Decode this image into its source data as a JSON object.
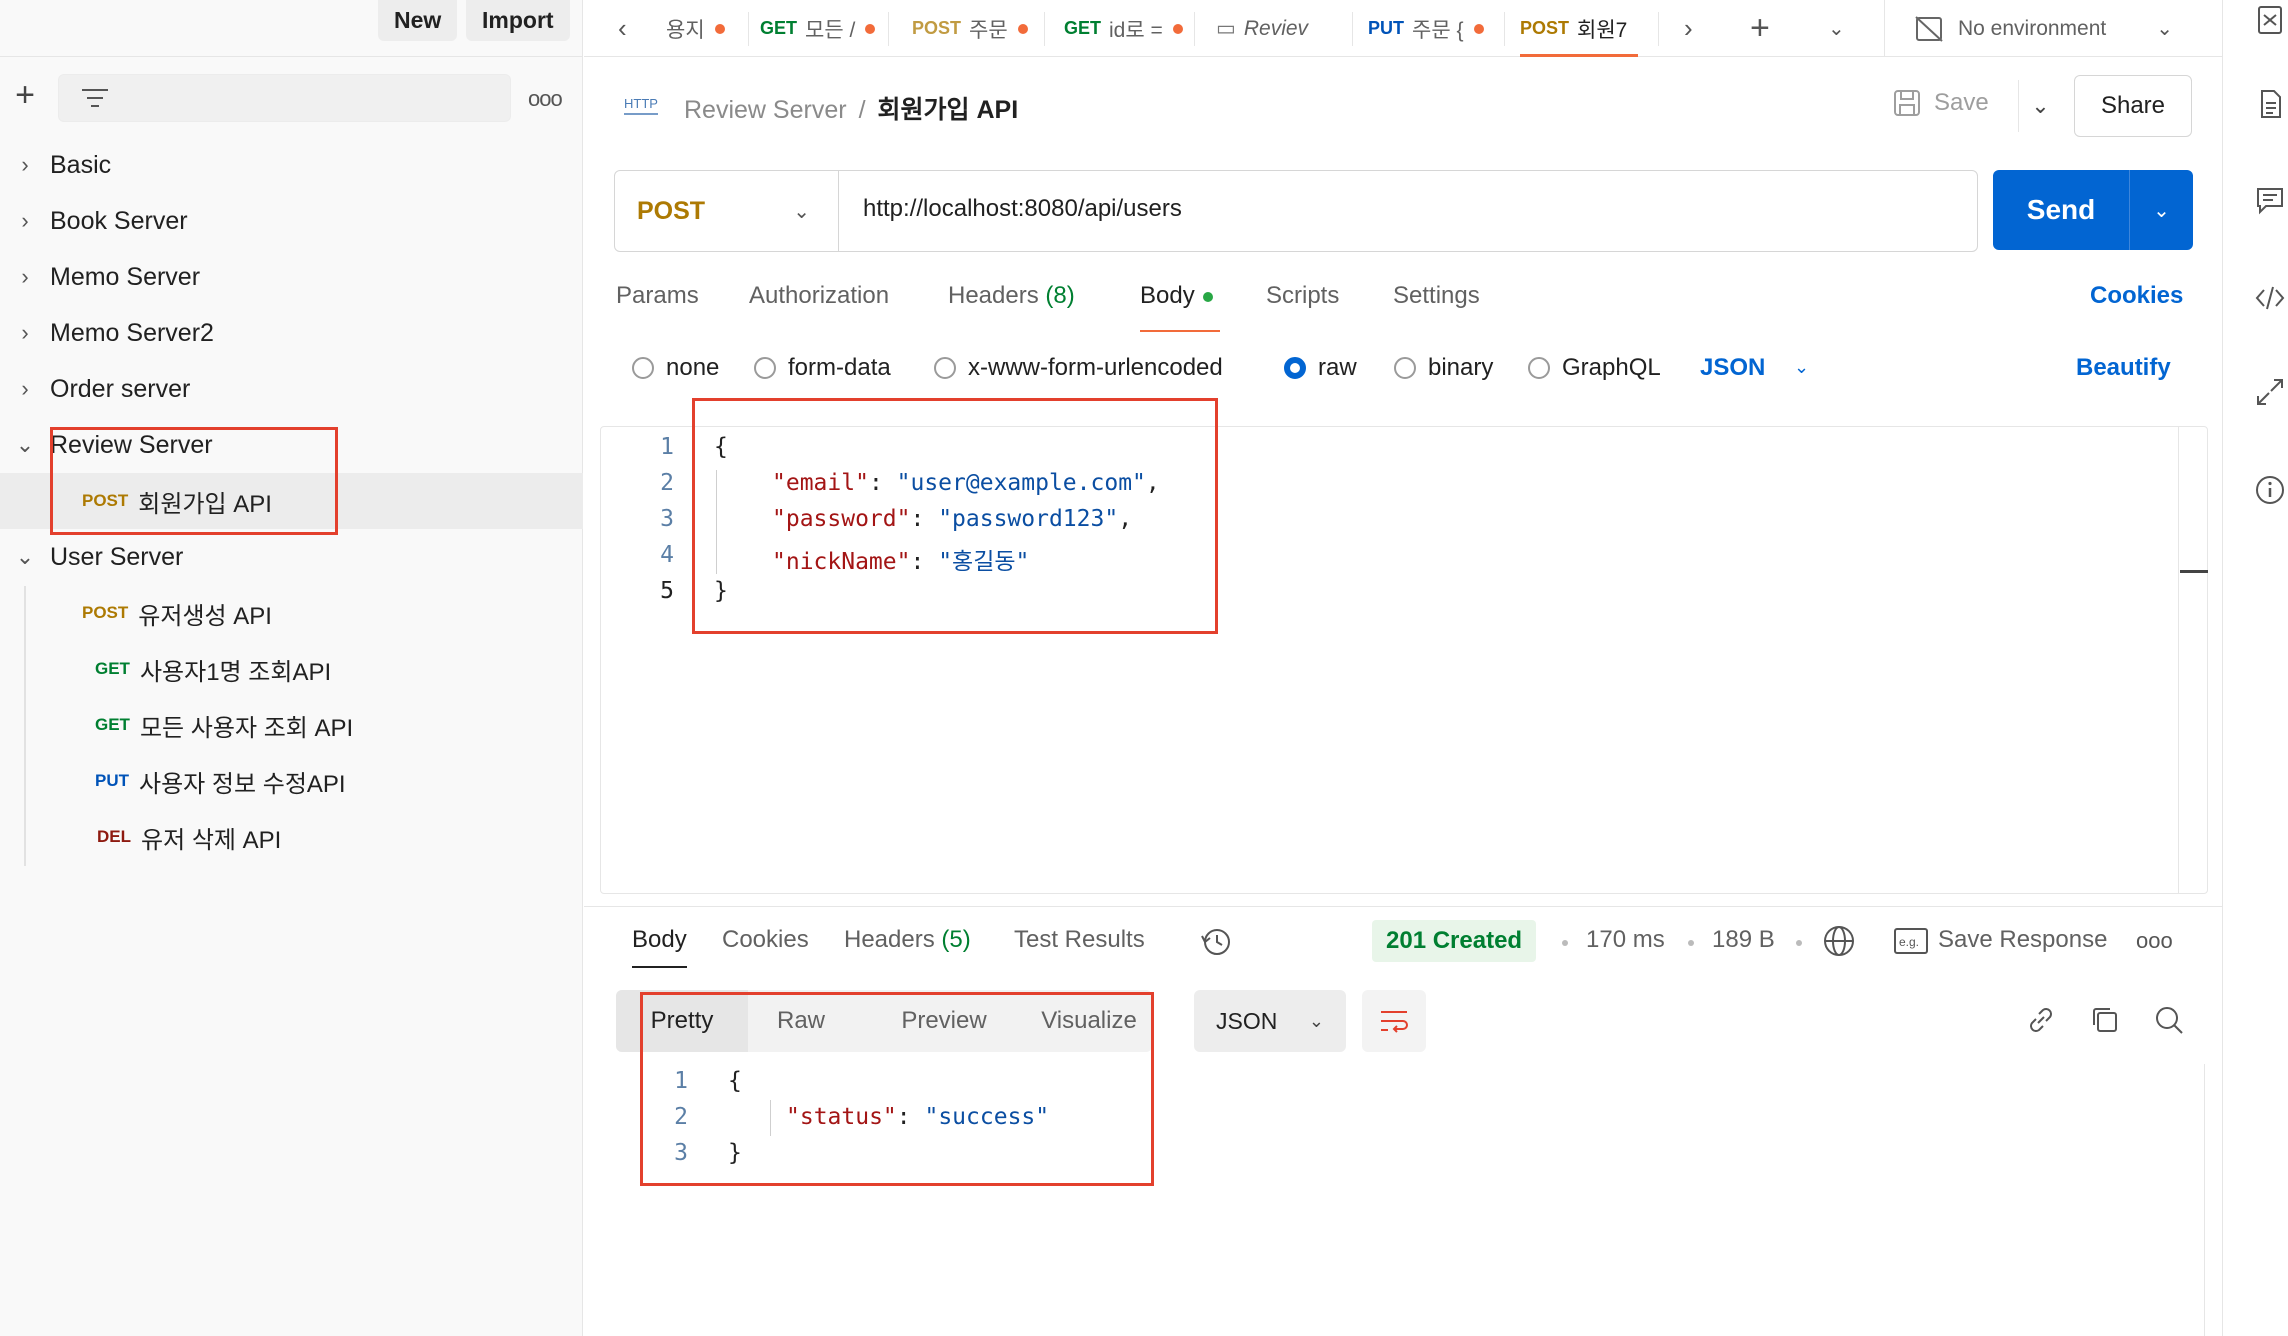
{
  "sidebar": {
    "new_label": "New",
    "import_label": "Import",
    "collections": [
      {
        "name": "Basic"
      },
      {
        "name": "Book Server"
      },
      {
        "name": "Memo Server"
      },
      {
        "name": "Memo Server2"
      },
      {
        "name": "Order server"
      },
      {
        "name": "Review Server",
        "expanded": true
      },
      {
        "name": "User Server",
        "expanded": true
      }
    ],
    "review_requests": [
      {
        "method": "POST",
        "name": "회원가입 API"
      }
    ],
    "user_requests": [
      {
        "method": "POST",
        "name": "유저생성 API"
      },
      {
        "method": "GET",
        "name": "사용자1명 조회API"
      },
      {
        "method": "GET",
        "name": "모든 사용자 조회 API"
      },
      {
        "method": "PUT",
        "name": "사용자 정보 수정API"
      },
      {
        "method": "DEL",
        "name": "유저 삭제 API"
      }
    ]
  },
  "tabs": [
    {
      "method": "",
      "name": "용지",
      "dot": true
    },
    {
      "method": "GET",
      "name": "모든 /",
      "dot": true
    },
    {
      "method": "POST",
      "name": "주문",
      "dot": true
    },
    {
      "method": "GET",
      "name": "id로 =",
      "dot": true
    },
    {
      "method": "",
      "name": "Reviev",
      "dot": false
    },
    {
      "method": "PUT",
      "name": "주문 {",
      "dot": true
    },
    {
      "method": "POST",
      "name": "회원7",
      "dot": false
    }
  ],
  "environment": "No environment",
  "request": {
    "breadcrumb_parent": "Review Server",
    "breadcrumb_sep": "/",
    "breadcrumb_current": "회원가입 API",
    "save_label": "Save",
    "share_label": "Share",
    "method": "POST",
    "url": "http://localhost:8080/api/users",
    "send_label": "Send",
    "tabs": {
      "params": "Params",
      "authorization": "Authorization",
      "headers": "Headers",
      "headers_count": "(8)",
      "body": "Body",
      "scripts": "Scripts",
      "settings": "Settings"
    },
    "cookies_label": "Cookies",
    "body_types": [
      "none",
      "form-data",
      "x-www-form-urlencoded",
      "raw",
      "binary",
      "GraphQL"
    ],
    "selected_body_type": "raw",
    "format": "JSON",
    "beautify_label": "Beautify",
    "body_lines": [
      "1",
      "2",
      "3",
      "4",
      "5"
    ],
    "body": {
      "open": "{",
      "close": "}",
      "email_key": "\"email\"",
      "email_val": "\"user@example.com\"",
      "password_key": "\"password\"",
      "password_val": "\"password123\"",
      "nickname_key": "\"nickName\"",
      "nickname_val": "\"홍길동\""
    }
  },
  "response": {
    "tabs": {
      "body": "Body",
      "cookies": "Cookies",
      "headers": "Headers",
      "headers_count": "(5)",
      "test_results": "Test Results"
    },
    "status": "201 Created",
    "time": "170 ms",
    "size": "189 B",
    "save_response_label": "Save Response",
    "views": [
      "Pretty",
      "Raw",
      "Preview",
      "Visualize"
    ],
    "format": "JSON",
    "body_lines": [
      "1",
      "2",
      "3"
    ],
    "body": {
      "open": "{",
      "close": "}",
      "status_key": "\"status\"",
      "status_val": "\"success\""
    }
  },
  "colors": {
    "accent": "#0265d2",
    "post": "#ad7a03",
    "get": "#007f31",
    "put": "#0053b8",
    "del": "#8e1a10",
    "highlight_box": "#e3402d"
  }
}
